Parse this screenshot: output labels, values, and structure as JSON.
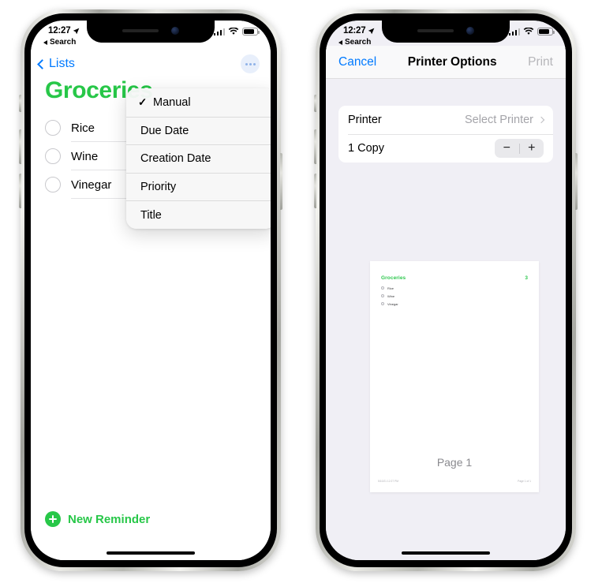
{
  "phones": {
    "left": {
      "status": {
        "time": "12:27",
        "location_icon": "location-arrow-icon",
        "back_app_label": "Search",
        "signal_icon": "cellular-bars-icon",
        "wifi_icon": "wifi-icon",
        "battery_icon": "battery-icon"
      },
      "nav": {
        "back_label": "Lists",
        "back_icon": "chevron-left-icon",
        "more_icon": "ellipsis-circle-icon"
      },
      "list": {
        "title": "Groceries",
        "title_color": "#27c748",
        "items": [
          {
            "label": "Rice"
          },
          {
            "label": "Wine"
          },
          {
            "label": "Vinegar"
          }
        ]
      },
      "new_reminder": {
        "label": "New Reminder",
        "icon": "plus-circle-icon",
        "color": "#27c748"
      },
      "dropdown": {
        "checkmark": "✓",
        "items": [
          {
            "label": "Manual",
            "checked": true
          },
          {
            "label": "Due Date",
            "checked": false
          },
          {
            "label": "Creation Date",
            "checked": false
          },
          {
            "label": "Priority",
            "checked": false
          },
          {
            "label": "Title",
            "checked": false
          }
        ]
      }
    },
    "right": {
      "status": {
        "time": "12:27",
        "location_icon": "location-arrow-icon",
        "back_app_label": "Search",
        "signal_icon": "cellular-bars-icon",
        "wifi_icon": "wifi-icon",
        "battery_icon": "battery-icon"
      },
      "sheet": {
        "cancel_label": "Cancel",
        "title": "Printer Options",
        "print_label": "Print",
        "accent_color": "#007aff",
        "print_disabled_color": "#b6b6ba"
      },
      "options": [
        {
          "key": "Printer",
          "value": "Select Printer",
          "chevron_icon": "chevron-right-icon",
          "type": "navigation"
        },
        {
          "key": "1 Copy",
          "type": "stepper",
          "minus_label": "−",
          "plus_label": "+"
        }
      ],
      "preview": {
        "doc_title": "Groceries",
        "doc_count": "3",
        "doc_title_color": "#2fc84f",
        "items": [
          {
            "label": "Rice"
          },
          {
            "label": "Wine"
          },
          {
            "label": "Vinegar"
          }
        ],
        "page_label": "Page 1",
        "footer_left": "5/10/21 12:27 PM",
        "footer_right": "Page 1 of 1"
      }
    }
  }
}
